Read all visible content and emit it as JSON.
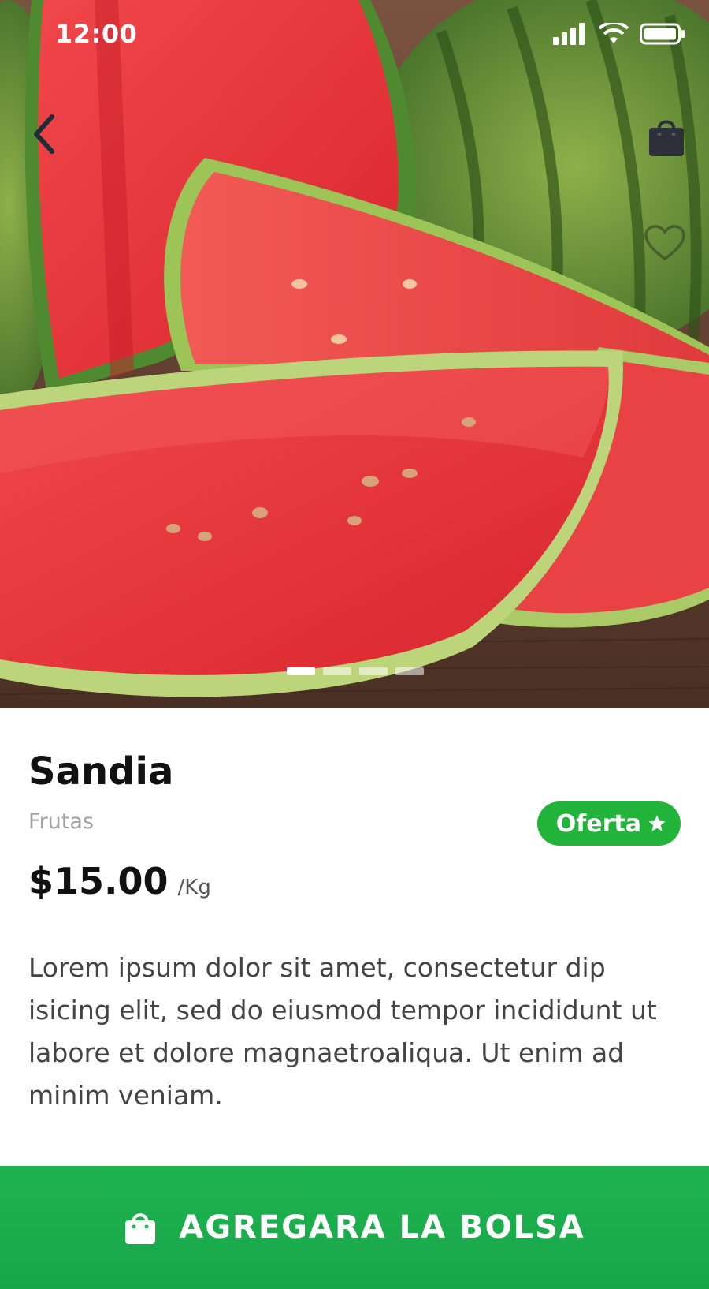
{
  "status_bar": {
    "time": "12:00",
    "icons": [
      "signal-icon",
      "wifi-icon",
      "battery-icon"
    ]
  },
  "hero": {
    "carousel": {
      "total": 4,
      "active_index": 0
    },
    "icons": {
      "back": "chevron-left-icon",
      "bag": "shopping-bag-icon",
      "favorite": "heart-icon"
    }
  },
  "product": {
    "name": "Sandia",
    "category": "Frutas",
    "badge": "Oferta",
    "badge_icon": "star-icon",
    "price": "$15.00",
    "unit": "/Kg",
    "description": "Lorem ipsum dolor sit amet, consectetur dip isicing elit, sed do eiusmod tempor incididunt ut labore et dolore magnaetroaliqua. Ut enim ad minim veniam."
  },
  "cta": {
    "label": "AGREGARA LA BOLSA",
    "icon": "shopping-bag-icon"
  },
  "colors": {
    "accent_green": "#22b43a",
    "cta_green": "#1fb34f",
    "title": "#111111",
    "muted": "#a3a3a3",
    "body_text": "#444444"
  }
}
